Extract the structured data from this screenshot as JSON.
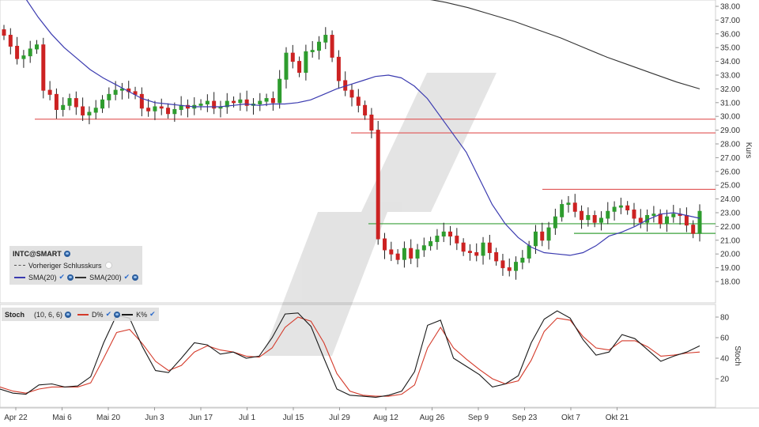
{
  "chart_data": [
    {
      "type": "candlestick",
      "title": "INTC@SMART",
      "ylabel": "Kurs",
      "ylim": [
        16.6,
        38.6
      ],
      "y_ticks": [
        "18.00",
        "19.00",
        "20.00",
        "21.00",
        "22.00",
        "23.00",
        "24.00",
        "25.00",
        "26.00",
        "27.00",
        "28.00",
        "29.00",
        "30.00",
        "31.00",
        "32.00",
        "33.00",
        "34.00",
        "35.00",
        "36.00",
        "37.00",
        "38.00"
      ],
      "x_ticks": [
        "Apr 22",
        "Mai 6",
        "Mai 20",
        "Jun 3",
        "Jun 17",
        "Jul 1",
        "Jul 15",
        "Jul 29",
        "Aug 12",
        "Aug 26",
        "Sep 9",
        "Sep 23",
        "Okt 7",
        "Okt 21"
      ],
      "legend": [
        {
          "label": "INTC@SMART",
          "kind": "title"
        },
        {
          "label": "Vorheriger Schlusskurs",
          "kind": "dashed",
          "color": "#555555"
        },
        {
          "label": "SMA(20)",
          "kind": "line",
          "color": "#3b3bb0"
        },
        {
          "label": "SMA(200)",
          "kind": "line",
          "color": "#333333"
        }
      ],
      "colors": {
        "up": "#2e9c2e",
        "down": "#cc2222",
        "sma20": "#3b3bb0",
        "sma200": "#333333",
        "resistance": "#e05555",
        "support": "#3aa03a"
      },
      "closes": [
        35.9,
        35.1,
        34.2,
        34.4,
        34.9,
        35.2,
        31.9,
        31.6,
        30.5,
        30.8,
        31.3,
        30.7,
        30.1,
        30.3,
        30.6,
        31.2,
        31.6,
        31.9,
        32.0,
        31.8,
        31.6,
        30.6,
        30.4,
        30.7,
        30.6,
        30.2,
        30.5,
        30.8,
        30.6,
        30.8,
        30.9,
        31.1,
        30.6,
        30.7,
        31.1,
        31.0,
        31.2,
        30.8,
        30.9,
        31.1,
        31.3,
        31.0,
        32.7,
        34.6,
        34.0,
        33.2,
        34.7,
        34.8,
        35.4,
        35.9,
        34.3,
        32.6,
        31.9,
        31.4,
        30.8,
        30.1,
        29.0,
        21.1,
        20.3,
        20.0,
        19.6,
        20.4,
        19.7,
        20.3,
        20.6,
        20.9,
        21.3,
        21.6,
        21.3,
        20.8,
        20.2,
        20.1,
        19.9,
        20.8,
        20.1,
        19.5,
        19.0,
        18.8,
        19.4,
        19.7,
        20.6,
        21.6,
        21.0,
        21.9,
        22.7,
        23.6,
        23.7,
        23.1,
        22.5,
        22.8,
        22.3,
        22.6,
        23.1,
        23.4,
        23.5,
        23.2,
        22.6,
        22.3,
        22.8,
        22.9,
        22.2,
        22.7,
        22.9,
        22.8,
        22.1,
        21.5,
        23.1
      ],
      "sma20": [
        38.6,
        37.2,
        36.0,
        35.0,
        34.2,
        33.4,
        32.8,
        32.3,
        31.8,
        31.3,
        31.0,
        30.9,
        30.8,
        30.7,
        30.7,
        30.7,
        30.8,
        30.9,
        30.8,
        30.9,
        30.9,
        31.0,
        31.2,
        31.6,
        32.0,
        32.3,
        32.6,
        32.9,
        33.0,
        32.8,
        32.2,
        31.3,
        30.0,
        28.7,
        27.4,
        25.5,
        23.6,
        22.2,
        21.2,
        20.5,
        20.1,
        20.0,
        19.9,
        20.1,
        20.6,
        21.3,
        21.6,
        22.0,
        22.5,
        22.9,
        23.0,
        22.8,
        22.6
      ],
      "sma200": [
        38.9,
        38.8,
        38.6,
        38.3,
        37.9,
        37.4,
        36.9,
        36.3,
        35.7,
        35.0,
        34.3,
        33.7,
        33.1,
        32.5,
        32.0
      ],
      "resistance_levels": [
        29.8,
        28.8,
        24.7
      ],
      "support_levels": [
        22.2,
        21.5
      ]
    },
    {
      "type": "line",
      "title": "Stoch",
      "ylabel": "Stoch",
      "ylim": [
        0,
        100
      ],
      "y_ticks": [
        "20",
        "40",
        "60",
        "80"
      ],
      "legend": [
        {
          "label": "Stoch",
          "kind": "title"
        },
        {
          "label": "(10, 6, 6)",
          "kind": "params"
        },
        {
          "label": "D%",
          "kind": "line",
          "color": "#d43a2a"
        },
        {
          "label": "K%",
          "kind": "line",
          "color": "#1a1a1a"
        }
      ],
      "series": [
        {
          "name": "K%",
          "values": [
            10,
            6,
            5,
            14,
            15,
            12,
            13,
            22,
            55,
            82,
            79,
            51,
            28,
            26,
            40,
            55,
            53,
            44,
            46,
            40,
            42,
            60,
            83,
            84,
            71,
            40,
            10,
            4,
            3,
            2,
            4,
            8,
            27,
            72,
            77,
            40,
            32,
            24,
            12,
            15,
            23,
            55,
            78,
            86,
            79,
            58,
            43,
            46,
            63,
            59,
            48,
            37,
            42,
            46,
            52
          ]
        },
        {
          "name": "D%",
          "values": [
            12,
            8,
            6,
            10,
            12,
            12,
            12,
            16,
            40,
            65,
            68,
            54,
            37,
            28,
            33,
            46,
            52,
            48,
            46,
            42,
            41,
            50,
            70,
            80,
            76,
            55,
            25,
            8,
            4,
            3,
            3,
            5,
            14,
            50,
            70,
            50,
            39,
            29,
            20,
            15,
            18,
            38,
            66,
            79,
            77,
            61,
            50,
            48,
            57,
            57,
            51,
            42,
            43,
            45,
            46
          ]
        }
      ]
    }
  ]
}
